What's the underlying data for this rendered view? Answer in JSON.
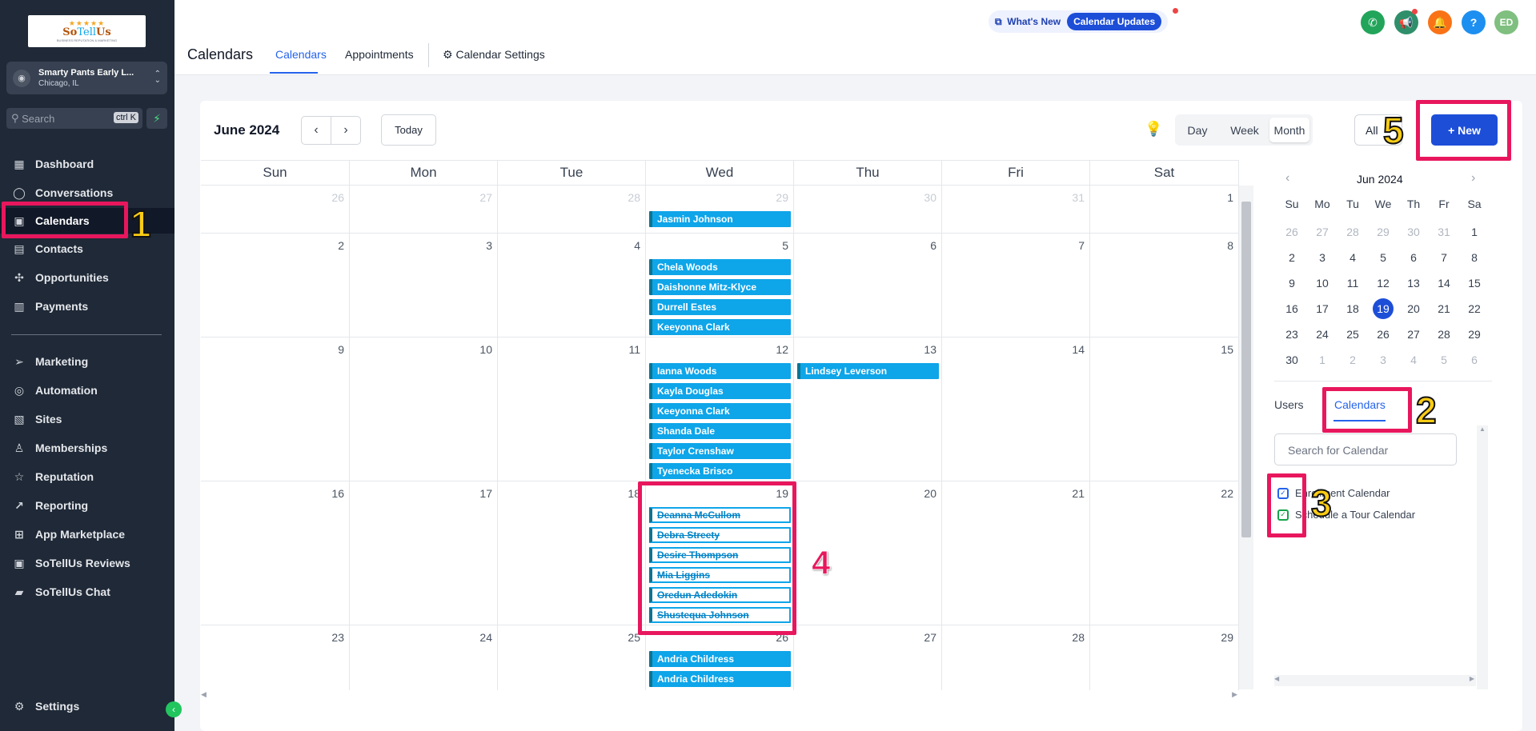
{
  "sidebar": {
    "logo": {
      "stars": "★★★★★",
      "brand_a": "So",
      "brand_b": "Tell",
      "brand_c": "Us",
      "tagline": "BUSINESS REPUTATION & MARKETING"
    },
    "account": {
      "name": "Smarty Pants Early L...",
      "location": "Chicago, IL"
    },
    "search": {
      "placeholder": "Search",
      "shortcut": "ctrl K"
    },
    "items": [
      {
        "label": "Dashboard",
        "icon": "grid-icon"
      },
      {
        "label": "Conversations",
        "icon": "chat-icon"
      },
      {
        "label": "Calendars",
        "icon": "calendar-icon"
      },
      {
        "label": "Contacts",
        "icon": "contacts-icon"
      },
      {
        "label": "Opportunities",
        "icon": "opportunities-icon"
      },
      {
        "label": "Payments",
        "icon": "payments-icon"
      },
      {
        "label": "Marketing",
        "icon": "send-icon"
      },
      {
        "label": "Automation",
        "icon": "automation-icon"
      },
      {
        "label": "Sites",
        "icon": "sites-icon"
      },
      {
        "label": "Memberships",
        "icon": "memberships-icon"
      },
      {
        "label": "Reputation",
        "icon": "star-icon"
      },
      {
        "label": "Reporting",
        "icon": "trend-icon"
      },
      {
        "label": "App Marketplace",
        "icon": "apps-icon"
      },
      {
        "label": "SoTellUs Reviews",
        "icon": "reviews-icon"
      },
      {
        "label": "SoTellUs Chat",
        "icon": "chat-box-icon"
      }
    ],
    "settings": "Settings"
  },
  "header": {
    "title": "Calendars",
    "tabs": [
      "Calendars",
      "Appointments",
      "Calendar Settings"
    ],
    "whats_new": "What's New",
    "calendar_updates": "Calendar Updates",
    "user_initials": "ED",
    "help": "?"
  },
  "calendar": {
    "month_label": "June 2024",
    "today": "Today",
    "views": [
      "Day",
      "Week",
      "Month"
    ],
    "selected_view": "Month",
    "filter": "All",
    "new_button": "+ New",
    "weekdays": [
      "Sun",
      "Mon",
      "Tue",
      "Wed",
      "Thu",
      "Fri",
      "Sat"
    ],
    "weeks": [
      [
        "26",
        "27",
        "28",
        "29",
        "30",
        "31",
        "1"
      ],
      [
        "2",
        "3",
        "4",
        "5",
        "6",
        "7",
        "8"
      ],
      [
        "9",
        "10",
        "11",
        "12",
        "13",
        "14",
        "15"
      ],
      [
        "16",
        "17",
        "18",
        "19",
        "20",
        "21",
        "22"
      ],
      [
        "23",
        "24",
        "25",
        "26",
        "27",
        "28",
        "29"
      ]
    ],
    "events": {
      "w0_wed": [
        "Jasmin Johnson"
      ],
      "w1_wed": [
        "Chela Woods",
        "Daishonne Mitz-Klyce",
        "Durrell  Estes",
        "Keeyonna Clark"
      ],
      "w2_wed": [
        "Ianna Woods",
        "Kayla Douglas",
        "Keeyonna Clark",
        "Shanda Dale",
        "Taylor Crenshaw",
        "Tyenecka Brisco"
      ],
      "w2_thu": [
        "Lindsey Leverson"
      ],
      "w3_wed_cancelled": [
        "Deanna McCullom",
        "Debra Streety",
        "Desire Thompson",
        "Mia Liggins",
        "Oredun Adedokin",
        "Shustequa  Johnson"
      ],
      "w4_wed": [
        "Andria Childress",
        "Andria Childress"
      ]
    }
  },
  "mini_calendar": {
    "title": "Jun 2024",
    "heads": [
      "Su",
      "Mo",
      "Tu",
      "We",
      "Th",
      "Fr",
      "Sa"
    ],
    "rows": [
      [
        "26",
        "27",
        "28",
        "29",
        "30",
        "31",
        "1"
      ],
      [
        "2",
        "3",
        "4",
        "5",
        "6",
        "7",
        "8"
      ],
      [
        "9",
        "10",
        "11",
        "12",
        "13",
        "14",
        "15"
      ],
      [
        "16",
        "17",
        "18",
        "19",
        "20",
        "21",
        "22"
      ],
      [
        "23",
        "24",
        "25",
        "26",
        "27",
        "28",
        "29"
      ],
      [
        "30",
        "1",
        "2",
        "3",
        "4",
        "5",
        "6"
      ]
    ],
    "selected_day": "19"
  },
  "right_panel": {
    "tabs": [
      "Users",
      "Calendars"
    ],
    "active_tab": "Calendars",
    "search_placeholder": "Search for Calendar",
    "calendars": [
      "Enrollment Calendar",
      "Schedule a Tour Calendar"
    ]
  },
  "annotations": [
    "1",
    "2",
    "3",
    "4",
    "5"
  ],
  "colors": {
    "sidebar": "#1f2937",
    "accent": "#1d4ed8",
    "event": "#0ea5e9",
    "highlight": "#e8175d",
    "badge_number": "#facc15"
  }
}
